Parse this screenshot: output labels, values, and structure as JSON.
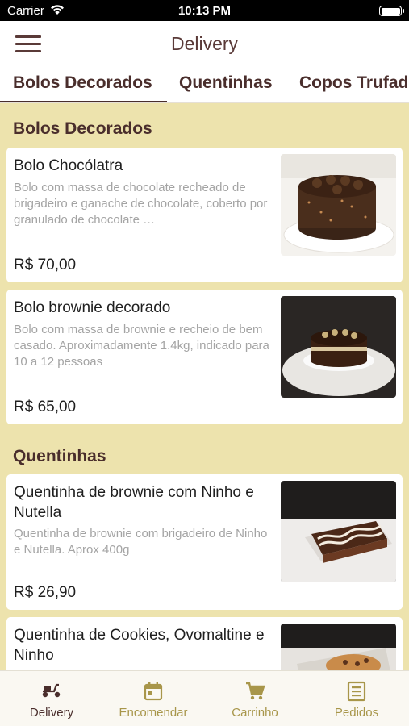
{
  "status_bar": {
    "carrier": "Carrier",
    "time": "10:13 PM"
  },
  "nav": {
    "title": "Delivery"
  },
  "tabs": [
    "Bolos Decorados",
    "Quentinhas",
    "Copos Trufados"
  ],
  "sections": [
    {
      "title": "Bolos Decorados",
      "items": [
        {
          "name": "Bolo Chocólatra",
          "description": "Bolo com massa de chocolate recheado de brigadeiro e ganache de chocolate, coberto por granulado de chocolate …",
          "price": "R$ 70,00"
        },
        {
          "name": "Bolo brownie decorado",
          "description": "Bolo com massa de brownie e recheio de bem casado. Aproximadamente 1.4kg, indicado para 10 a 12 pessoas",
          "price": "R$ 65,00"
        }
      ]
    },
    {
      "title": "Quentinhas",
      "items": [
        {
          "name": "Quentinha de brownie com Ninho e Nutella",
          "description": "Quentinha de brownie com brigadeiro de Ninho e Nutella. Aprox 400g",
          "price": "R$ 26,90"
        },
        {
          "name": "Quentinha de Cookies, Ovomaltine e Ninho",
          "description": "",
          "price": ""
        }
      ]
    }
  ],
  "tabbar": {
    "items": [
      {
        "label": "Delivery",
        "icon": "scooter-icon",
        "active": true
      },
      {
        "label": "Encomendar",
        "icon": "calendar-icon",
        "active": false
      },
      {
        "label": "Carrinho",
        "icon": "cart-icon",
        "active": false
      },
      {
        "label": "Pedidos",
        "icon": "receipt-icon",
        "active": false
      }
    ]
  },
  "colors": {
    "primary": "#4a2e2c",
    "background": "#ede3ad",
    "tab_active": "#4a2e2c",
    "tab_inactive": "#a8964a"
  }
}
